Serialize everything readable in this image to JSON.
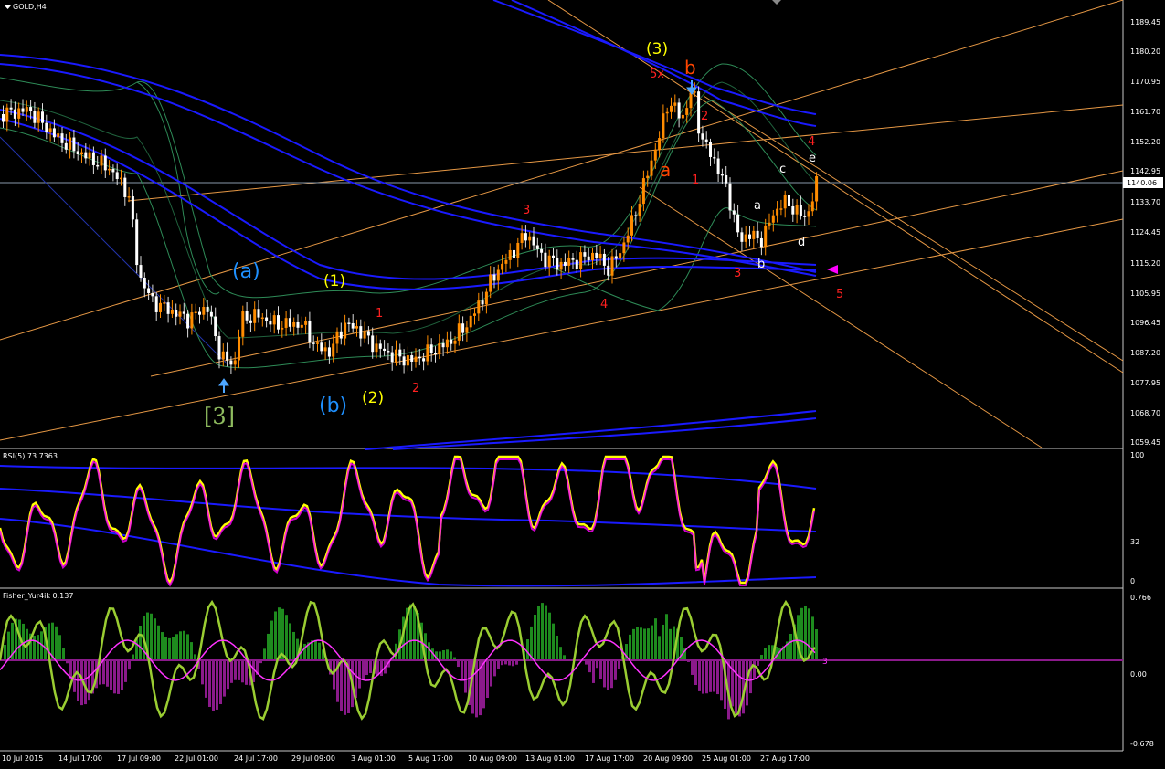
{
  "window": {
    "symbol": "GOLD,H4"
  },
  "panes": {
    "price": {
      "scale": [
        "1189.45",
        "1180.20",
        "1170.95",
        "1161.70",
        "1152.20",
        "1142.95",
        "1133.70",
        "1124.45",
        "1115.20",
        "1105.95",
        "1096.45",
        "1087.20",
        "1077.95",
        "1068.70",
        "1059.45"
      ],
      "current_price": "1140.06"
    },
    "rsi": {
      "label": "RSI(5) 73.7363",
      "scale": [
        "100",
        "32",
        "0"
      ]
    },
    "fisher": {
      "label": "Fisher_Yur4ik 0.137",
      "scale": [
        "0.766",
        "0.00",
        "-0.678"
      ]
    }
  },
  "x_axis": [
    "10 Jul 2015",
    "14 Jul 17:00",
    "17 Jul 09:00",
    "22 Jul 01:00",
    "24 Jul 17:00",
    "29 Jul 09:00",
    "3 Aug 01:00",
    "5 Aug 17:00",
    "10 Aug 09:00",
    "13 Aug 01:00",
    "17 Aug 17:00",
    "20 Aug 09:00",
    "25 Aug 01:00",
    "27 Aug 17:00"
  ],
  "wave_labels": {
    "a_paren": "(a)",
    "b_paren": "(b)",
    "bracket3": "[3]",
    "w1": "(1)",
    "w2": "(2)",
    "w3": "(3)",
    "r1": "1",
    "r2": "2",
    "r3": "3",
    "r4": "4",
    "big_a": "a",
    "big_b": "b",
    "five_x": "5x",
    "c2": "2",
    "c1": "1",
    "c3": "3",
    "c4": "4",
    "c5": "5",
    "s_a": "a",
    "s_b": "b",
    "s_c": "c",
    "s_d": "d",
    "s_e": "e"
  },
  "colors": {
    "candle_up": "#ff8c00",
    "candle_down": "#ffffff",
    "band": "#1a1aff",
    "envelope": "#2e8b57",
    "trendline": "#ffa94d",
    "rsi": "#ffff00",
    "fisher_pos": "#1e8b1e",
    "fisher_neg": "#8b1a8b",
    "fisher_line": "#9acd32",
    "fisher_signal": "#ff33ff",
    "label_red": "#ff2020",
    "label_yellow": "#ffff00",
    "label_cyan": "#1e90ff",
    "label_green": "#8fbc5f"
  }
}
